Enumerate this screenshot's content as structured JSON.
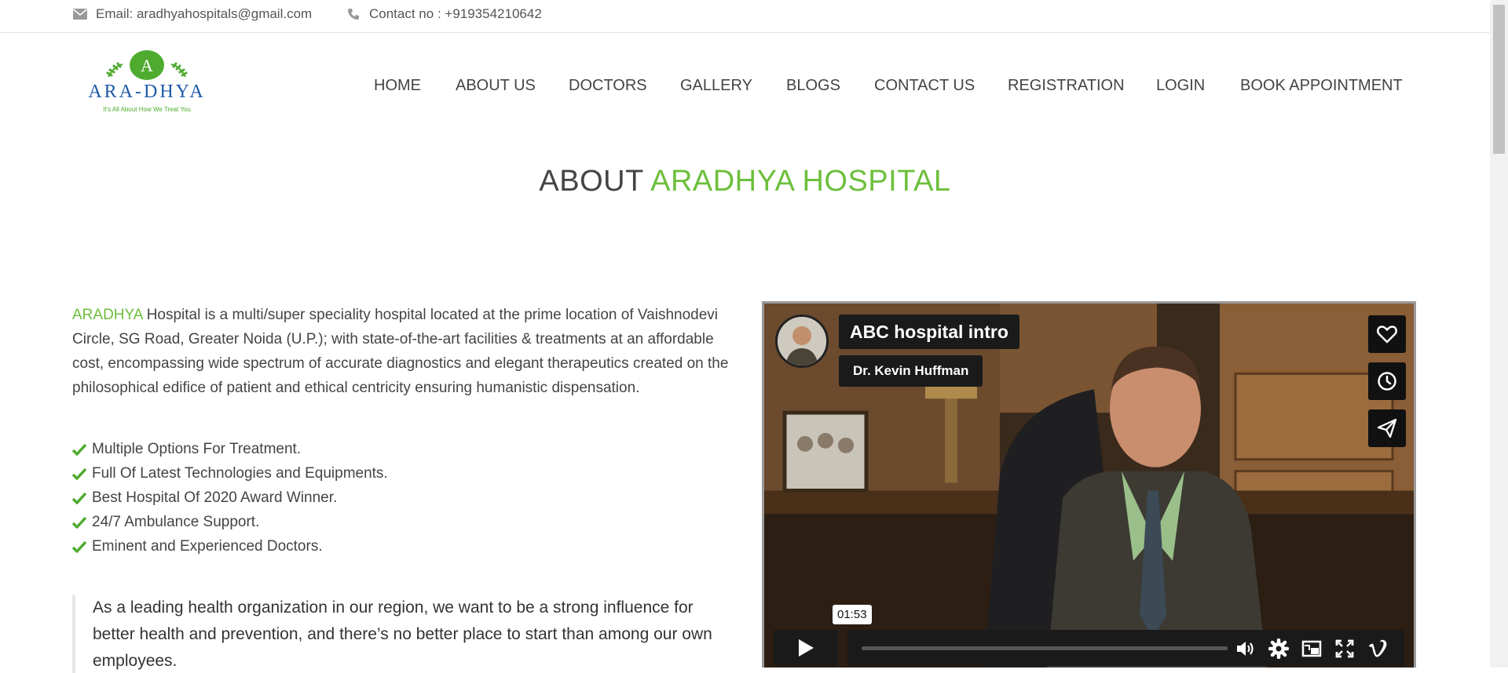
{
  "topbar": {
    "email": "Email: aradhyahospitals@gmail.com",
    "contact": "Contact no : +919354210642"
  },
  "logo": {
    "letter": "A",
    "name": "ARA-DHYA",
    "tagline": "It's All About How We Treat You",
    "color": "#1f5aa8",
    "accent": "#4eab2f"
  },
  "nav": {
    "items": [
      "HOME",
      "ABOUT US",
      "DOCTORS",
      "GALLERY",
      "BLOGS",
      "CONTACT US",
      "REGISTRATION",
      "LOGIN",
      "BOOK APPOINTMENT"
    ]
  },
  "page": {
    "title_part1": "ABOUT",
    "title_part2": "ARADHYA HOSPITAL",
    "accent_color": "#6dbf3c"
  },
  "about": {
    "brand": "ARADHYA",
    "text": "Hospital is a multi/super speciality hospital located at the prime location of Vaishnodevi Circle, SG Road, Greater Noida (U.P.); with state-of-the-art facilities & treatments at an affordable cost, encompassing wide spectrum of accurate diagnostics and elegant therapeutics created on the philosophical edifice of patient and ethical centricity ensuring humanistic dispensation.",
    "features": [
      "Multiple Options For Treatment.",
      "Full Of Latest Technologies and Equipments.",
      "Best Hospital Of 2020 Award Winner.",
      "24/7 Ambulance Support.",
      "Eminent and Experienced Doctors."
    ],
    "quote": "As a leading health organization in our region, we want to be a strong influence for better health and prevention, and there’s no better place to start than among our own employees."
  },
  "video": {
    "title": "ABC hospital intro",
    "author": "Dr. Kevin Huffman",
    "time": "01:53",
    "progress": 0
  }
}
